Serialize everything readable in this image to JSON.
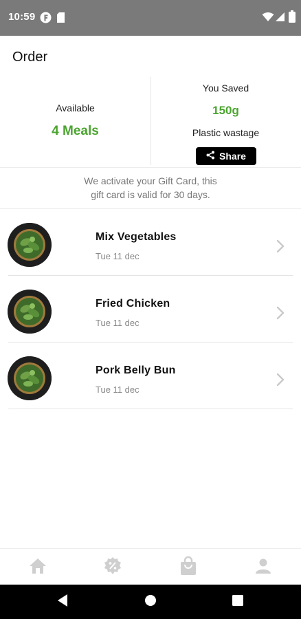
{
  "status_bar": {
    "time": "10:59",
    "left_icons": [
      "f-badge-icon",
      "sim-card-icon"
    ],
    "right_icons": [
      "wifi-icon",
      "signal-icon",
      "battery-icon"
    ]
  },
  "header": {
    "title": "Order"
  },
  "stats": {
    "available_label": "Available",
    "available_value": "4 Meals",
    "saved_label": "You Saved",
    "saved_value": "150g",
    "wastage_label": "Plastic wastage",
    "share_label": "Share",
    "accent_color": "#4aa52e"
  },
  "notice": {
    "line1": "We activate your Gift Card, this",
    "line2": "gift card is valid for 30 days."
  },
  "orders": [
    {
      "name": "Mix Vegetables",
      "date": "Tue 11 dec"
    },
    {
      "name": "Fried Chicken",
      "date": "Tue 11 dec"
    },
    {
      "name": "Pork Belly Bun",
      "date": "Tue 11 dec"
    }
  ],
  "bottom_nav": [
    "home-icon",
    "discount-badge-icon",
    "shopping-bag-icon",
    "person-icon"
  ],
  "system_nav": [
    "back-icon",
    "home-circle-icon",
    "recents-icon"
  ]
}
